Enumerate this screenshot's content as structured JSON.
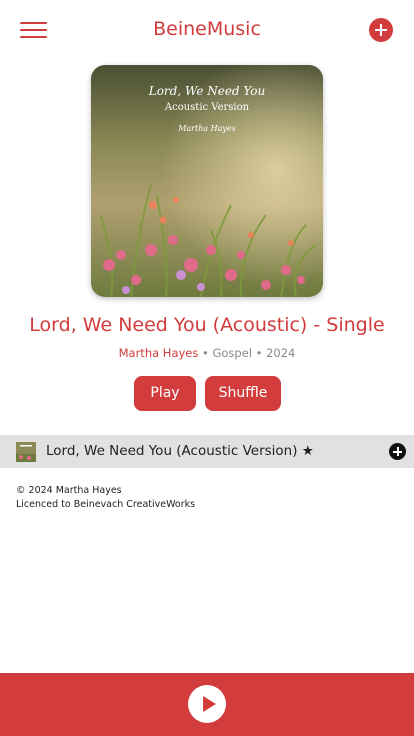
{
  "header": {
    "title": "BeineMusic",
    "menu_icon": "hamburger-menu-icon",
    "add_icon": "plus-circle-icon"
  },
  "album": {
    "cover": {
      "title": "Lord, We Need You",
      "subtitle": "Acoustic Version",
      "artist": "Martha Hayes"
    },
    "title": "Lord, We Need You (Acoustic) - Single",
    "artist": "Martha Hayes",
    "separator": " • ",
    "genre": "Gospel",
    "year": "2024"
  },
  "actions": {
    "play_label": "Play",
    "shuffle_label": "Shuffle"
  },
  "tracks": [
    {
      "title": "Lord, We Need You (Acoustic Version) ★",
      "add_icon": "plus-circle-icon"
    }
  ],
  "footer": {
    "copyright": "© 2024 Martha Hayes",
    "license": "Licenced to Beinevach CreativeWorks"
  },
  "player": {
    "play_icon": "play-circle-icon"
  },
  "colors": {
    "accent": "#d23c3c",
    "track_row_bg": "#e1e1e1",
    "muted_text": "#888888"
  }
}
